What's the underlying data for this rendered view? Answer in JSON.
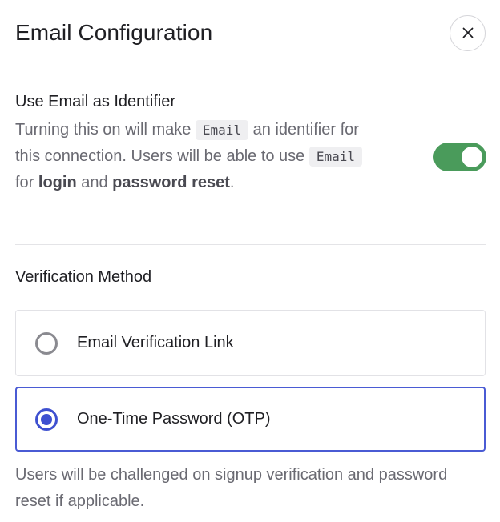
{
  "header": {
    "title": "Email Configuration",
    "close_icon": "close-icon"
  },
  "identifier": {
    "title": "Use Email as Identifier",
    "desc_part1": "Turning this on will make ",
    "code1": "Email",
    "desc_part2": " an identifier for this connection. Users will be able to use ",
    "code2": "Email",
    "desc_part3": " for ",
    "bold1": "login",
    "desc_part4": " and ",
    "bold2": "password reset",
    "desc_part5": ".",
    "toggle_on": true,
    "toggle_color": "#4a9b5b"
  },
  "verification": {
    "title": "Verification Method",
    "options": [
      {
        "label": "Email Verification Link",
        "selected": false
      },
      {
        "label": "One-Time Password (OTP)",
        "selected": true
      }
    ],
    "accent_color": "#3e50d0",
    "note": "Users will be challenged on signup verification and password reset if applicable."
  }
}
